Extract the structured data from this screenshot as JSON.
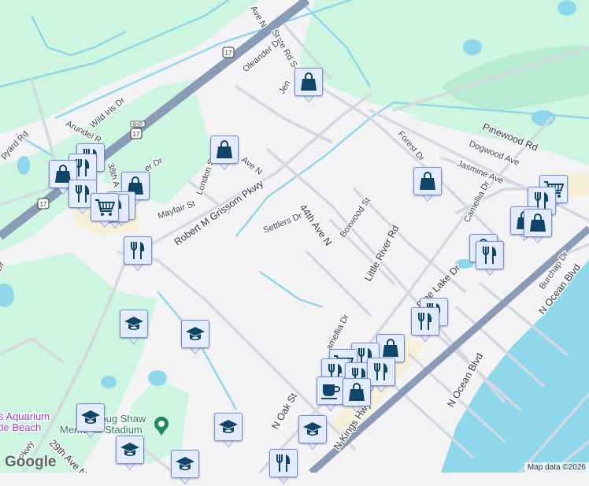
{
  "map": {
    "colors": {
      "land": "#f3f3f5",
      "park": "#cdf5e0",
      "water": "#8fd8ec",
      "highway": "#8a9cb5",
      "road": "#d4d9e0",
      "beach": "#f6f0d9",
      "marker_fill": "#e4ebfb",
      "marker_icon": "#0f4568"
    },
    "streets": {
      "state_rd": "State Rd S-26-17",
      "oleander": "Oleander Dr",
      "jen": "Jen",
      "ave_n_top": "Ave N",
      "wild_iris": "Wild Iris Dr",
      "arundel": "Arundel R",
      "shipyard": "pyard Rd",
      "th38": "38th A",
      "er_dr": "er Dr",
      "london": "London St",
      "ave_n": "Ave N",
      "mayfair": "Mayfair St",
      "grissom": "Robert M Grissom Pkwy",
      "settlers": "Settlers Dr",
      "ave44": "44th Ave N",
      "boxwood": "Boxwood St",
      "little_river": "Little River Rd",
      "forest": "Forest Dr",
      "pinewood": "Pinewood Rd",
      "dogwood": "Dogwood Ave",
      "jasmine": "Jasmine Ave",
      "camellia": "Camellia Dr",
      "camellia2": "amellia Dr",
      "pine_lake": "Pine Lake Dr",
      "burchap": "Burchap Dr",
      "n_ocean": "N Ocean Blvd",
      "n_ocean2": "N Ocean Blvd",
      "n_oak": "N Oak St",
      "kings": "N Kings Hwy",
      "ave29": "29th Ave N",
      "pkwy": "Pkwy",
      "dr_left": "Dr"
    },
    "shields": {
      "us17_a": "17",
      "us17_b": "17",
      "us17_c": "17",
      "byp": "BYP",
      "us17_byp": "17"
    },
    "pois": {
      "aquarium_1": "s Aquarium",
      "aquarium_2": "tle Beach",
      "stadium_1": "Doug Shaw",
      "stadium_2": "Memorial Stadium"
    },
    "markers": [
      {
        "type": "shopping"
      },
      {
        "type": "shopping"
      },
      {
        "type": "restaurant"
      },
      {
        "type": "restaurant"
      },
      {
        "type": "shopping"
      },
      {
        "type": "restaurant"
      },
      {
        "type": "shopping"
      },
      {
        "type": "restaurant"
      },
      {
        "type": "restaurant"
      },
      {
        "type": "grocery"
      },
      {
        "type": "restaurant"
      },
      {
        "type": "school"
      },
      {
        "type": "school"
      },
      {
        "type": "shopping"
      },
      {
        "type": "grocery"
      },
      {
        "type": "restaurant"
      },
      {
        "type": "shopping"
      },
      {
        "type": "shopping"
      },
      {
        "type": "shopping"
      },
      {
        "type": "restaurant"
      },
      {
        "type": "restaurant"
      },
      {
        "type": "restaurant"
      },
      {
        "type": "shopping"
      },
      {
        "type": "restaurant"
      },
      {
        "type": "grocery"
      },
      {
        "type": "restaurant"
      },
      {
        "type": "restaurant"
      },
      {
        "type": "restaurant"
      },
      {
        "type": "cafe"
      },
      {
        "type": "shopping"
      },
      {
        "type": "school"
      },
      {
        "type": "school"
      },
      {
        "type": "school"
      },
      {
        "type": "school"
      },
      {
        "type": "school"
      },
      {
        "type": "restaurant"
      }
    ],
    "attribution": "Map data ©2026",
    "logo": "Google"
  }
}
